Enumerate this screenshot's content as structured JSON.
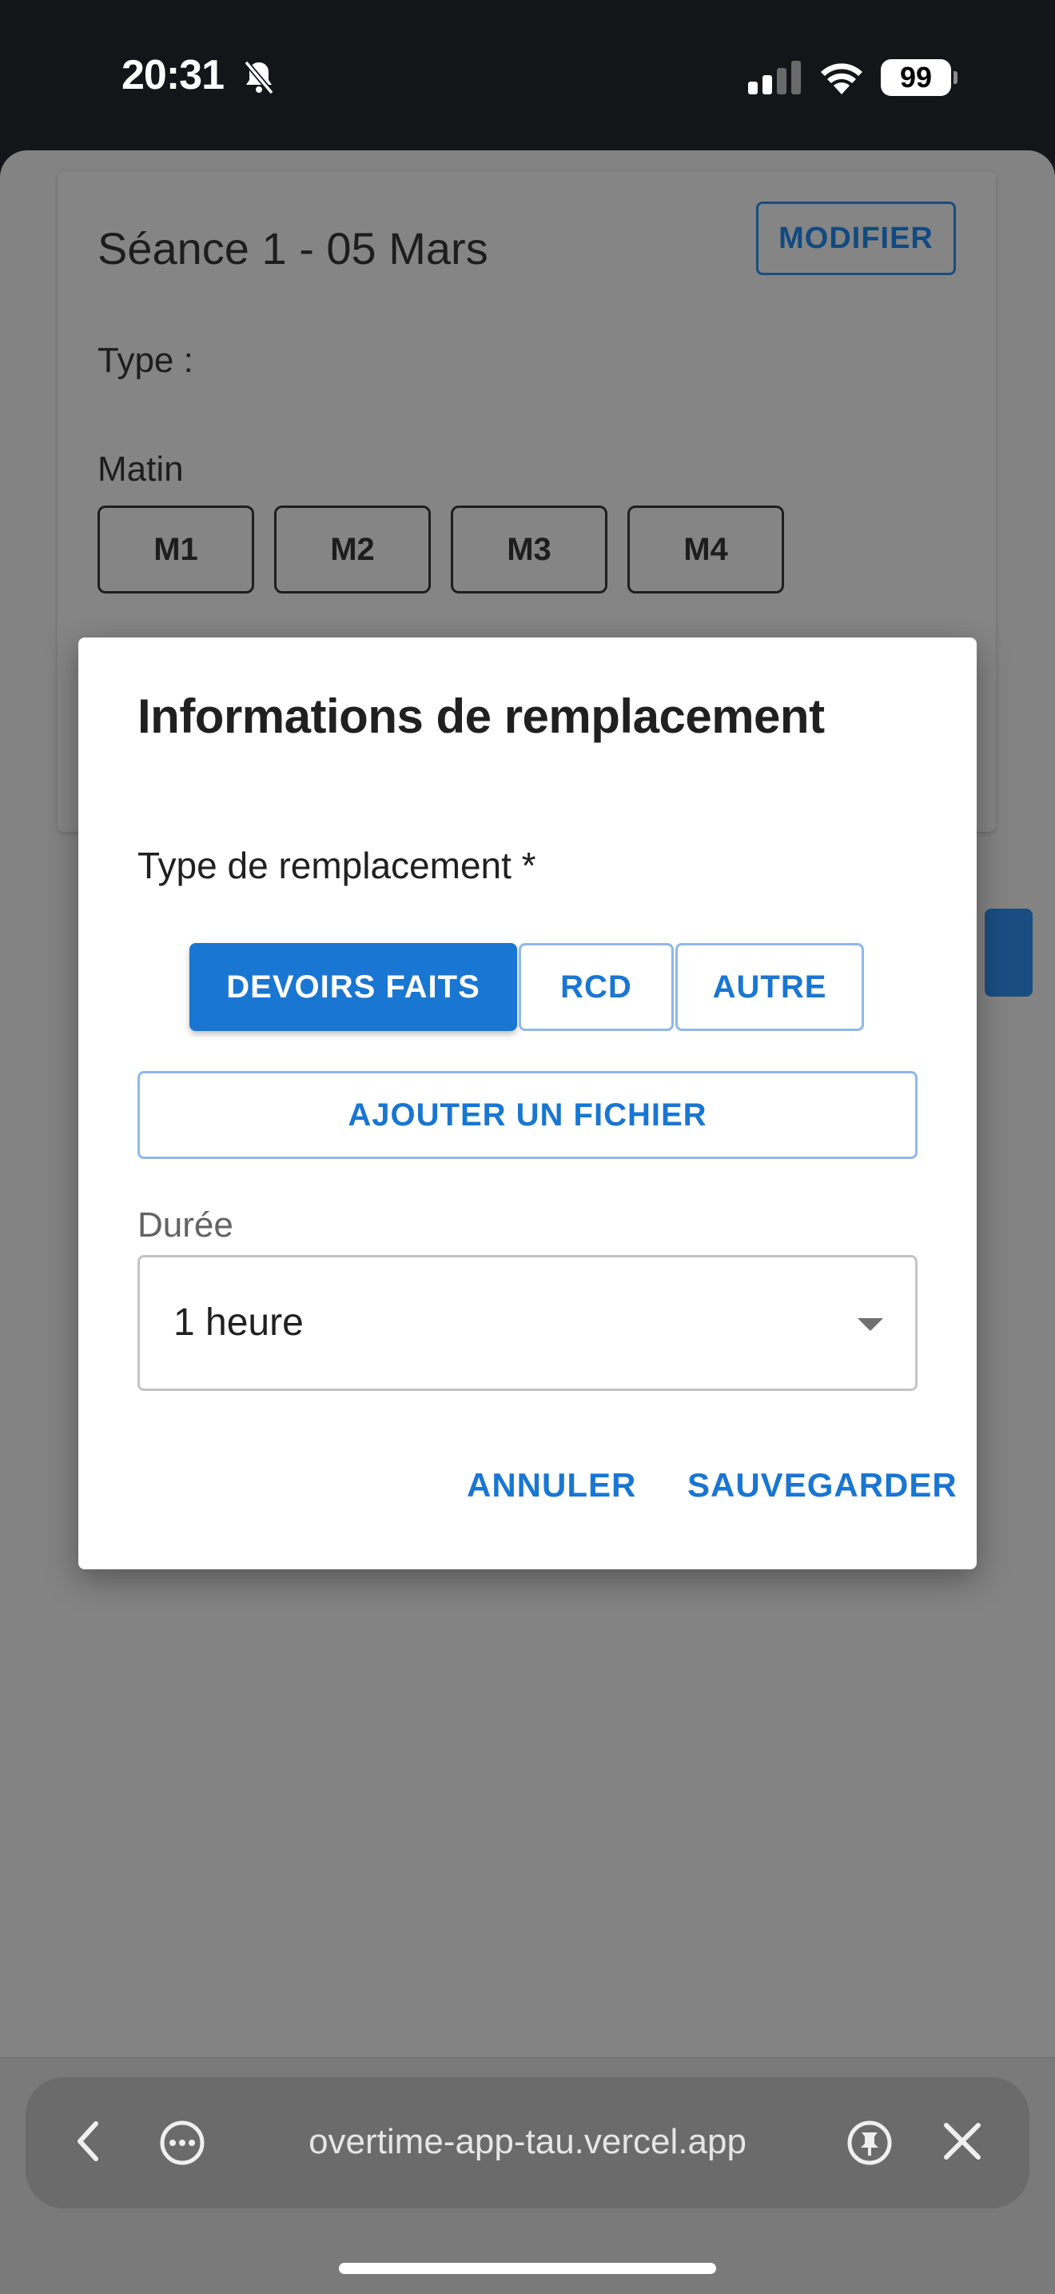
{
  "status_bar": {
    "time": "20:31",
    "battery": "99",
    "icons": [
      "bell-slash-icon",
      "signal-icon",
      "wifi-icon",
      "battery-icon"
    ]
  },
  "session_card": {
    "title": "Séance 1 - 05 Mars",
    "modify_label": "MODIFIER",
    "type_label": "Type :",
    "morning_label": "Matin",
    "slots": [
      "M1",
      "M2",
      "M3",
      "M4"
    ]
  },
  "dialog": {
    "title": "Informations de remplacement",
    "replacement_type_label": "Type de remplacement *",
    "options": [
      "DEVOIRS FAITS",
      "RCD",
      "AUTRE"
    ],
    "selected_option": "DEVOIRS FAITS",
    "add_file_label": "AJOUTER UN FICHIER",
    "duration_label": "Durée",
    "duration_value": "1 heure",
    "cancel_label": "ANNULER",
    "save_label": "SAUVEGARDER"
  },
  "browser": {
    "url": "overtime-app-tau.vercel.app"
  },
  "colors": {
    "primary": "#1976d2",
    "overlay_bg": "#838383",
    "status_bg": "#141519"
  }
}
